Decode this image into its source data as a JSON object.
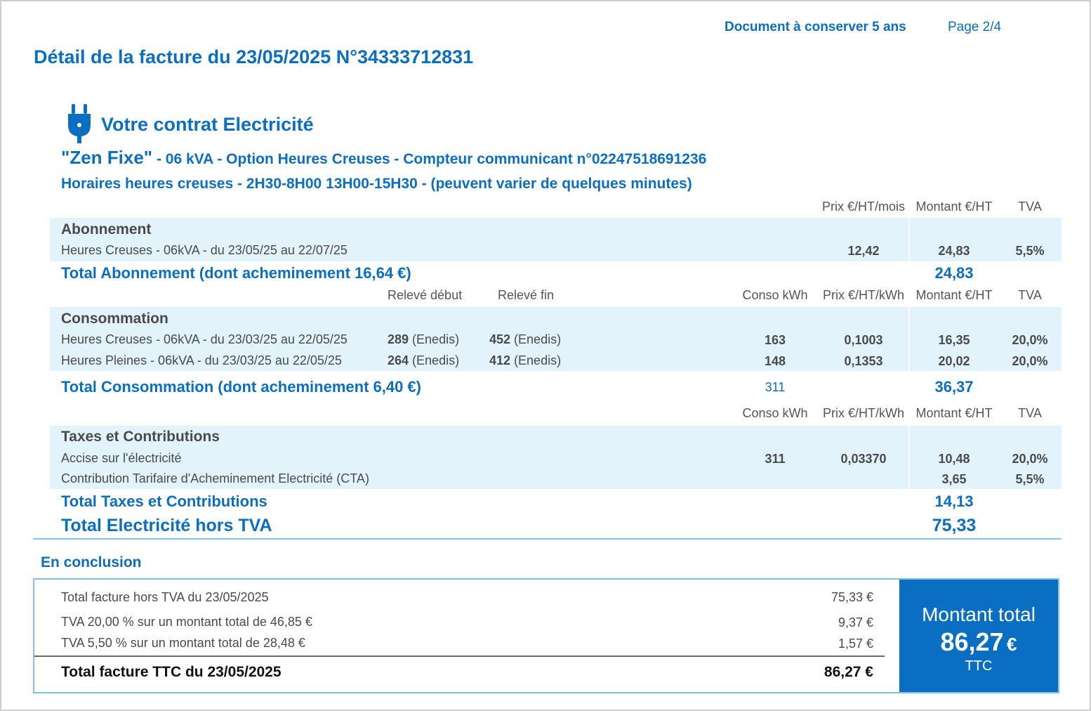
{
  "header": {
    "conserve": "Document à conserver 5 ans",
    "page": "Page 2/4",
    "title": "Détail de la facture du 23/05/2025 N°34333712831"
  },
  "contract": {
    "heading": "Votre contrat Electricité",
    "offer_name": "\"Zen Fixe\"",
    "offer_details": " - 06 kVA - Option Heures Creuses - Compteur communicant n°02247518691236",
    "hours": "Horaires heures creuses - 2H30-8H00 13H00-15H30 - (peuvent varier de quelques minutes)"
  },
  "abonnement": {
    "col_price": "Prix €/HT/mois",
    "col_amount": "Montant €/HT",
    "col_tva": "TVA",
    "section": "Abonnement",
    "row_label": "Heures Creuses - 06kVA - du 23/05/25 au 22/07/25",
    "row_price": "12,42",
    "row_amount": "24,83",
    "row_tva": "5,5%",
    "total_label": "Total Abonnement (dont acheminement 16,64 €)",
    "total_amount": "24,83"
  },
  "consommation": {
    "col_start": "Relevé début",
    "col_end": "Relevé fin",
    "col_conso": "Conso kWh",
    "col_price": "Prix €/HT/kWh",
    "col_amount": "Montant €/HT",
    "col_tva": "TVA",
    "section": "Consommation",
    "rows": [
      {
        "label": "Heures Creuses - 06kVA - du 23/03/25 au 22/05/25",
        "start": "289",
        "start_src": " (Enedis)",
        "end": "452",
        "end_src": " (Enedis)",
        "conso": "163",
        "price": "0,1003",
        "amount": "16,35",
        "tva": "20,0%"
      },
      {
        "label": "Heures Pleines - 06kVA - du 23/03/25 au 22/05/25",
        "start": "264",
        "start_src": " (Enedis)",
        "end": "412",
        "end_src": " (Enedis)",
        "conso": "148",
        "price": "0,1353",
        "amount": "20,02",
        "tva": "20,0%"
      }
    ],
    "total_label": "Total Consommation (dont acheminement 6,40 €)",
    "total_conso": "311",
    "total_amount": "36,37"
  },
  "taxes": {
    "col_conso": "Conso kWh",
    "col_price": "Prix €/HT/kWh",
    "col_amount": "Montant €/HT",
    "col_tva": "TVA",
    "section": "Taxes et Contributions",
    "rows": [
      {
        "label": "Accise sur l'électricité",
        "conso": "311",
        "price": "0,03370",
        "amount": "10,48",
        "tva": "20,0%"
      },
      {
        "label": "Contribution Tarifaire d'Acheminement Electricité (CTA)",
        "conso": "",
        "price": "",
        "amount": "3,65",
        "tva": "5,5%"
      }
    ],
    "total_label": "Total Taxes et Contributions",
    "total_amount": "14,13"
  },
  "electricite_total": {
    "label": "Total Electricité hors TVA",
    "amount": "75,33"
  },
  "conclusion": {
    "heading": "En conclusion",
    "lines": [
      {
        "label": "Total facture hors TVA du 23/05/2025",
        "value": "75,33 €"
      },
      {
        "label": "TVA 20,00 % sur un montant total de 46,85 €",
        "value": "9,37 €"
      },
      {
        "label": "TVA 5,50 % sur un montant total de 28,48 €",
        "value": "1,57 €"
      }
    ],
    "ttc_label": "Total facture TTC du 23/05/2025",
    "ttc_value": "86,27 €",
    "box_title": "Montant total",
    "box_amount": "86,27",
    "box_currency": "€",
    "box_ttc": "TTC"
  },
  "icons": {
    "plug": "plug-icon"
  },
  "colors": {
    "accent": "#0a6fc2",
    "band": "#e3f3fb",
    "border": "#7ec3ea"
  }
}
